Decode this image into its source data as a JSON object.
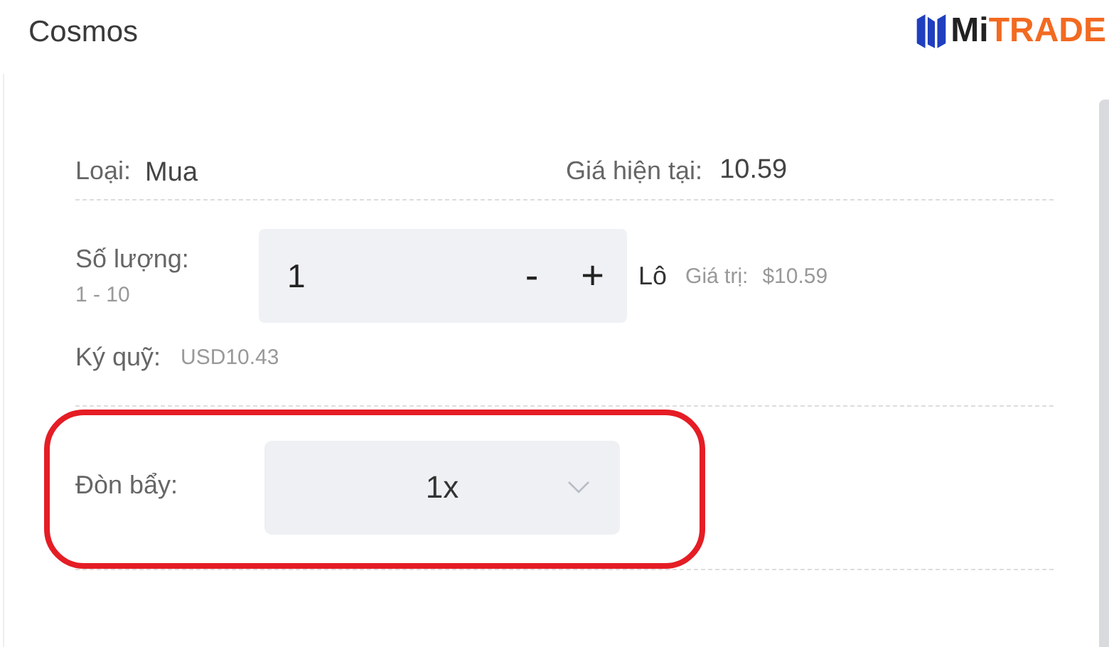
{
  "header": {
    "title": "Cosmos",
    "logo": {
      "part_1": "Mi",
      "part_2": "TRADE"
    }
  },
  "order": {
    "type_label": "Loại:",
    "type_value": "Mua",
    "price_label": "Giá hiện tại:",
    "price_value": "10.59",
    "quantity_label": "Số lượng:",
    "quantity_range": "1 - 10",
    "quantity_value": "1",
    "minus": "-",
    "plus": "+",
    "unit": "Lô",
    "value_label": "Giá trị:",
    "value_amount": "$10.59",
    "margin_label": "Ký quỹ:",
    "margin_value": "USD10.43",
    "leverage_label": "Đòn bẩy:",
    "leverage_value": "1x",
    "leverage_highlighted": true
  }
}
